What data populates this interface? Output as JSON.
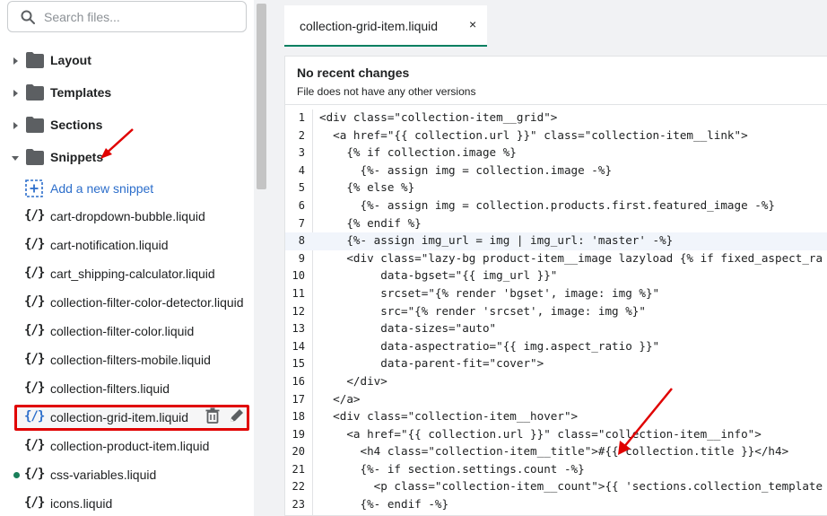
{
  "search": {
    "placeholder": "Search files..."
  },
  "folders": [
    {
      "label": "Layout",
      "expanded": false
    },
    {
      "label": "Templates",
      "expanded": false
    },
    {
      "label": "Sections",
      "expanded": false
    },
    {
      "label": "Snippets",
      "expanded": true
    }
  ],
  "add_snippet_label": "Add a new snippet",
  "file_icon": "{/}",
  "files": [
    {
      "name": "cart-dropdown-bubble.liquid"
    },
    {
      "name": "cart-notification.liquid"
    },
    {
      "name": "cart_shipping-calculator.liquid"
    },
    {
      "name": "collection-filter-color-detector.liquid"
    },
    {
      "name": "collection-filter-color.liquid"
    },
    {
      "name": "collection-filters-mobile.liquid"
    },
    {
      "name": "collection-filters.liquid"
    },
    {
      "name": "collection-grid-item.liquid"
    },
    {
      "name": "collection-product-item.liquid"
    },
    {
      "name": "css-variables.liquid"
    },
    {
      "name": "icons.liquid"
    }
  ],
  "tab": {
    "label": "collection-grid-item.liquid",
    "close": "×"
  },
  "notice": {
    "title": "No recent changes",
    "subtitle": "File does not have any other versions"
  },
  "code_lines": [
    {
      "n": "1",
      "text": "<div class=\"collection-item__grid\">"
    },
    {
      "n": "2",
      "text": "  <a href=\"{{ collection.url }}\" class=\"collection-item__link\">"
    },
    {
      "n": "3",
      "text": "    {% if collection.image %}"
    },
    {
      "n": "4",
      "text": "      {%- assign img = collection.image -%}"
    },
    {
      "n": "5",
      "text": "    {% else %}"
    },
    {
      "n": "6",
      "text": "      {%- assign img = collection.products.first.featured_image -%}"
    },
    {
      "n": "7",
      "text": "    {% endif %}"
    },
    {
      "n": "8",
      "text": "    {%- assign img_url = img | img_url: 'master' -%}"
    },
    {
      "n": "9",
      "text": "    <div class=\"lazy-bg product-item__image lazyload {% if fixed_aspect_ra"
    },
    {
      "n": "10",
      "text": "         data-bgset=\"{{ img_url }}\""
    },
    {
      "n": "11",
      "text": "         srcset=\"{% render 'bgset', image: img %}\""
    },
    {
      "n": "12",
      "text": "         src=\"{% render 'srcset', image: img %}\""
    },
    {
      "n": "13",
      "text": "         data-sizes=\"auto\""
    },
    {
      "n": "14",
      "text": "         data-aspectratio=\"{{ img.aspect_ratio }}\""
    },
    {
      "n": "15",
      "text": "         data-parent-fit=\"cover\">"
    },
    {
      "n": "16",
      "text": "    </div>"
    },
    {
      "n": "17",
      "text": "  </a>"
    },
    {
      "n": "18",
      "text": "  <div class=\"collection-item__hover\">"
    },
    {
      "n": "19",
      "text": "    <a href=\"{{ collection.url }}\" class=\"collection-item__info\">"
    },
    {
      "n": "20",
      "text": "      <h4 class=\"collection-item__title\">#{{ collection.title }}</h4>"
    },
    {
      "n": "21",
      "text": "      {%- if section.settings.count -%}"
    },
    {
      "n": "22",
      "text": "        <p class=\"collection-item__count\">{{ 'sections.collection_template"
    },
    {
      "n": "23",
      "text": "      {%- endif -%}"
    }
  ],
  "colors": {
    "accent": "#2c6ecb",
    "active_tab_underline": "#008060",
    "annotation": "#e00000",
    "modified_dot": "#1a7f5a"
  }
}
